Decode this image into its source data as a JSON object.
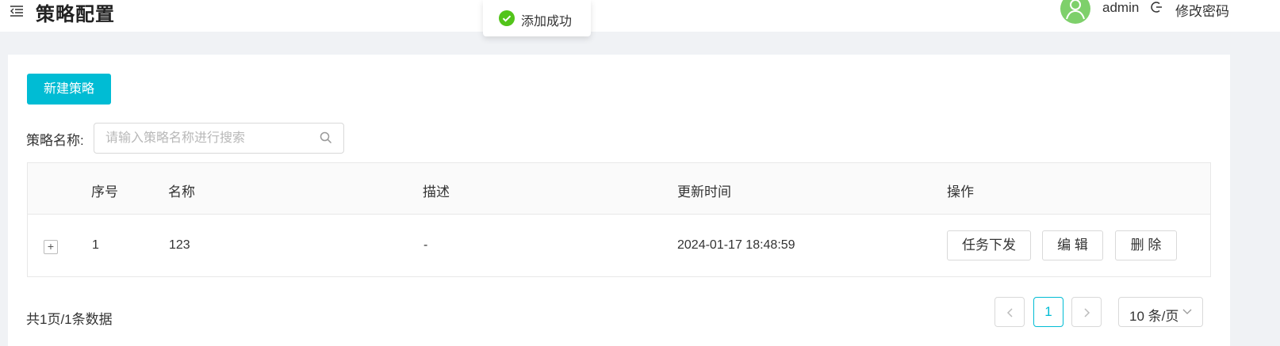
{
  "header": {
    "title": "策略配置",
    "username": "admin",
    "change_password": "修改密码"
  },
  "toast": {
    "message": "添加成功"
  },
  "toolbar": {
    "new_button": "新建策略"
  },
  "search": {
    "label": "策略名称:",
    "placeholder": "请输入策略名称进行搜索",
    "value": ""
  },
  "table": {
    "columns": [
      "序号",
      "名称",
      "描述",
      "更新时间",
      "操作"
    ],
    "rows": [
      {
        "index": "1",
        "name": "123",
        "description": "-",
        "updated": "2024-01-17 18:48:59",
        "actions": [
          "任务下发",
          "编 辑",
          "删 除"
        ]
      }
    ],
    "expand_symbol": "+"
  },
  "pagination": {
    "summary": "共1页/1条数据",
    "current_page": "1",
    "page_size": "10 条/页"
  },
  "colors": {
    "accent": "#00bcd4",
    "success": "#52c41a",
    "avatar": "#7ed06b"
  }
}
